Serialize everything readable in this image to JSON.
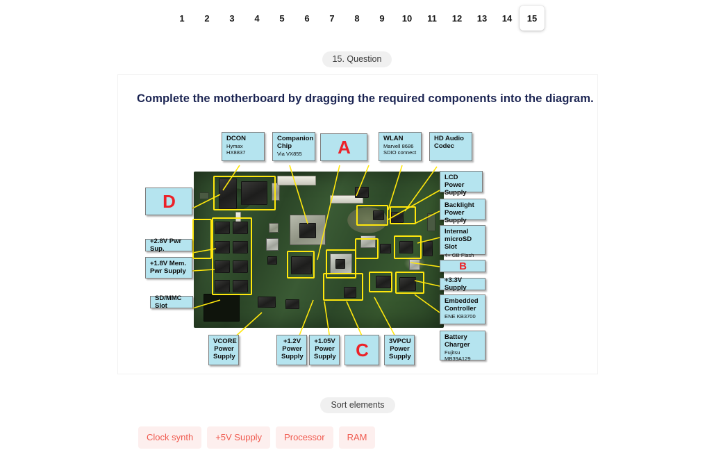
{
  "pagination": {
    "pages": [
      "1",
      "2",
      "3",
      "4",
      "5",
      "6",
      "7",
      "8",
      "9",
      "10",
      "11",
      "12",
      "13",
      "14",
      "15"
    ],
    "current": "15"
  },
  "question_pill": "15. Question",
  "question": {
    "title": "Complete the motherboard by dragging the required components into the diagram."
  },
  "diagram": {
    "callouts": [
      {
        "id": "dcon",
        "title": "DCON",
        "sub": "Hymax HX8837"
      },
      {
        "id": "companion-chip",
        "title": "Companion Chip",
        "sub": "Via VX855"
      },
      {
        "id": "zone-a",
        "letter": "A"
      },
      {
        "id": "wlan",
        "title": "WLAN",
        "sub": "Marvell 8686\nSDIO connect"
      },
      {
        "id": "hd-audio-codec",
        "title": "HD Audio Codec",
        "sub": ""
      },
      {
        "id": "lcd-power",
        "title": "LCD Power Supply",
        "sub": ""
      },
      {
        "id": "backlight-power",
        "title": "Backlight Power Supply",
        "sub": ""
      },
      {
        "id": "microsd",
        "title": "Internal microSD Slot",
        "sub": "4+ GB Flash"
      },
      {
        "id": "zone-b",
        "letter": "B"
      },
      {
        "id": "supply-3v3",
        "title": "+3.3V Supply",
        "sub": ""
      },
      {
        "id": "embedded-ctrl",
        "title": "Embedded Controller",
        "sub": "ENE KB3700"
      },
      {
        "id": "battery-charger",
        "title": "Battery Charger",
        "sub": "Fujitsu MB39A129"
      },
      {
        "id": "zone-d",
        "letter": "D"
      },
      {
        "id": "pwr-2v8",
        "title": "+2.8V Pwr Sup.",
        "sub": ""
      },
      {
        "id": "mem-1v8",
        "title": "+1.8V Mem. Pwr Supply",
        "sub": ""
      },
      {
        "id": "sd-mmc",
        "title": "SD/MMC Slot",
        "sub": ""
      },
      {
        "id": "vcore",
        "title": "VCORE Power Supply",
        "sub": ""
      },
      {
        "id": "pwr-1v2",
        "title": "+1.2V Power Supply",
        "sub": ""
      },
      {
        "id": "pwr-1v05",
        "title": "+1.05V Power Supply",
        "sub": ""
      },
      {
        "id": "zone-c",
        "letter": "C"
      },
      {
        "id": "pwr-3vpcu",
        "title": "3VPCU Power Supply",
        "sub": ""
      }
    ],
    "labels": {
      "dcon_title": "DCON",
      "dcon_sub": "Hymax HX8837",
      "companion_title_1": "Companion",
      "companion_title_2": "Chip",
      "companion_sub": "Via VX855",
      "a": "A",
      "wlan_title": "WLAN",
      "wlan_sub_1": "Marvell 8686",
      "wlan_sub_2": "SDIO connect",
      "hdaudio_1": "HD Audio",
      "hdaudio_2": "Codec",
      "lcdpwr_1": "LCD Power",
      "lcdpwr_2": "Supply",
      "backlight_1": "Backlight",
      "backlight_2": "Power Supply",
      "microsd_1": "Internal",
      "microsd_2": "microSD Slot",
      "microsd_sub": "4+ GB Flash",
      "b": "B",
      "supply33": "+3.3V Supply",
      "ec_1": "Embedded",
      "ec_2": "Controller",
      "ec_sub": "ENE KB3700",
      "batt_1": "Battery",
      "batt_2": "Charger",
      "batt_sub": "Fujitsu MB39A129",
      "d": "D",
      "pwr28": "+2.8V Pwr Sup.",
      "mem18_1": "+1.8V Mem.",
      "mem18_2": "Pwr Supply",
      "sdmmc": "SD/MMC Slot",
      "vcore_1": "VCORE",
      "vcore_2": "Power",
      "vcore_3": "Supply",
      "p12_1": "+1.2V",
      "p12_2": "Power",
      "p12_3": "Supply",
      "p105_1": "+1.05V",
      "p105_2": "Power",
      "p105_3": "Supply",
      "c": "C",
      "pcu_1": "3VPCU",
      "pcu_2": "Power",
      "pcu_3": "Supply"
    }
  },
  "sort_section": {
    "pill": "Sort elements",
    "items": [
      {
        "label": "Clock synth"
      },
      {
        "label": "+5V Supply"
      },
      {
        "label": "Processor"
      },
      {
        "label": "RAM"
      }
    ]
  },
  "colors": {
    "callout_fill": "#b5e4ef",
    "dropzone_letter": "#ec2128",
    "highlight": "#ffe70d",
    "title": "#1b2452",
    "chip_text": "#f05a4f",
    "chip_fill": "#fdefee"
  }
}
